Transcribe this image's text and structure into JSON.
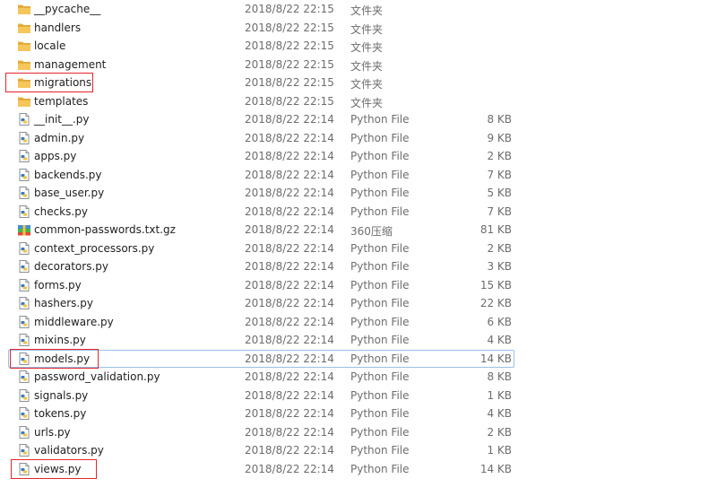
{
  "colors": {
    "folder": "#e8b13e",
    "highlight_box": "#e4262b",
    "selection_border": "#99c0e8",
    "meta_text": "#6d6d6d"
  },
  "files": [
    {
      "name": "__pycache__",
      "date": "2018/8/22 22:15",
      "type": "文件夹",
      "size": "",
      "icon": "folder-icon"
    },
    {
      "name": "handlers",
      "date": "2018/8/22 22:15",
      "type": "文件夹",
      "size": "",
      "icon": "folder-icon"
    },
    {
      "name": "locale",
      "date": "2018/8/22 22:15",
      "type": "文件夹",
      "size": "",
      "icon": "folder-icon"
    },
    {
      "name": "management",
      "date": "2018/8/22 22:15",
      "type": "文件夹",
      "size": "",
      "icon": "folder-icon"
    },
    {
      "name": "migrations",
      "date": "2018/8/22 22:15",
      "type": "文件夹",
      "size": "",
      "icon": "folder-icon"
    },
    {
      "name": "templates",
      "date": "2018/8/22 22:15",
      "type": "文件夹",
      "size": "",
      "icon": "folder-icon"
    },
    {
      "name": "__init__.py",
      "date": "2018/8/22 22:14",
      "type": "Python File",
      "size": "8 KB",
      "icon": "python-file-icon"
    },
    {
      "name": "admin.py",
      "date": "2018/8/22 22:14",
      "type": "Python File",
      "size": "9 KB",
      "icon": "python-file-icon"
    },
    {
      "name": "apps.py",
      "date": "2018/8/22 22:14",
      "type": "Python File",
      "size": "2 KB",
      "icon": "python-file-icon"
    },
    {
      "name": "backends.py",
      "date": "2018/8/22 22:14",
      "type": "Python File",
      "size": "7 KB",
      "icon": "python-file-icon"
    },
    {
      "name": "base_user.py",
      "date": "2018/8/22 22:14",
      "type": "Python File",
      "size": "5 KB",
      "icon": "python-file-icon"
    },
    {
      "name": "checks.py",
      "date": "2018/8/22 22:14",
      "type": "Python File",
      "size": "7 KB",
      "icon": "python-file-icon"
    },
    {
      "name": "common-passwords.txt.gz",
      "date": "2018/8/22 22:14",
      "type": "360压缩",
      "size": "81 KB",
      "icon": "archive-icon"
    },
    {
      "name": "context_processors.py",
      "date": "2018/8/22 22:14",
      "type": "Python File",
      "size": "2 KB",
      "icon": "python-file-icon"
    },
    {
      "name": "decorators.py",
      "date": "2018/8/22 22:14",
      "type": "Python File",
      "size": "3 KB",
      "icon": "python-file-icon"
    },
    {
      "name": "forms.py",
      "date": "2018/8/22 22:14",
      "type": "Python File",
      "size": "15 KB",
      "icon": "python-file-icon"
    },
    {
      "name": "hashers.py",
      "date": "2018/8/22 22:14",
      "type": "Python File",
      "size": "22 KB",
      "icon": "python-file-icon"
    },
    {
      "name": "middleware.py",
      "date": "2018/8/22 22:14",
      "type": "Python File",
      "size": "6 KB",
      "icon": "python-file-icon"
    },
    {
      "name": "mixins.py",
      "date": "2018/8/22 22:14",
      "type": "Python File",
      "size": "4 KB",
      "icon": "python-file-icon"
    },
    {
      "name": "models.py",
      "date": "2018/8/22 22:14",
      "type": "Python File",
      "size": "14 KB",
      "icon": "python-file-icon"
    },
    {
      "name": "password_validation.py",
      "date": "2018/8/22 22:14",
      "type": "Python File",
      "size": "8 KB",
      "icon": "python-file-icon"
    },
    {
      "name": "signals.py",
      "date": "2018/8/22 22:14",
      "type": "Python File",
      "size": "1 KB",
      "icon": "python-file-icon"
    },
    {
      "name": "tokens.py",
      "date": "2018/8/22 22:14",
      "type": "Python File",
      "size": "4 KB",
      "icon": "python-file-icon"
    },
    {
      "name": "urls.py",
      "date": "2018/8/22 22:14",
      "type": "Python File",
      "size": "2 KB",
      "icon": "python-file-icon"
    },
    {
      "name": "validators.py",
      "date": "2018/8/22 22:14",
      "type": "Python File",
      "size": "1 KB",
      "icon": "python-file-icon"
    },
    {
      "name": "views.py",
      "date": "2018/8/22 22:14",
      "type": "Python File",
      "size": "14 KB",
      "icon": "python-file-icon"
    }
  ]
}
